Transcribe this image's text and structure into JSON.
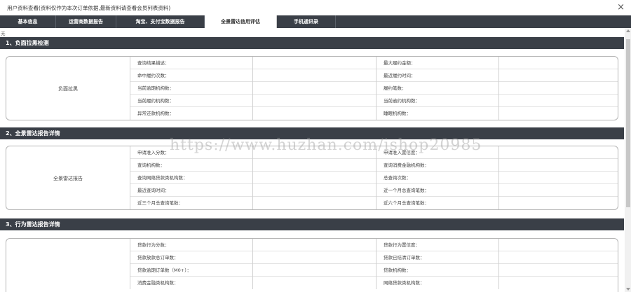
{
  "window": {
    "title": "用户资料查看(资料仅作为本次订单依据,最新资料请查看会员列表资料)",
    "close_glyph": "×"
  },
  "tabs": [
    {
      "label": "基本信息",
      "active": false
    },
    {
      "label": "运营商数据报告",
      "active": false
    },
    {
      "label": "淘宝、支付宝数据报告",
      "active": false
    },
    {
      "label": "全景雷达信用评估",
      "active": true
    },
    {
      "label": "手机通讯录",
      "active": false
    }
  ],
  "nodata_text": "无",
  "sections": [
    {
      "header": "1、负面拉黑检测",
      "group_label": "负面拉黑",
      "rows": [
        [
          "查询结果描述：",
          "最大履约金额："
        ],
        [
          "命中履约次数：",
          "最近履约时间："
        ],
        [
          "当前逾期机构数：",
          "履约笔数："
        ],
        [
          "当前履约机构数：",
          "当前逾约机构数："
        ],
        [
          "异常还款机构数：",
          "睡眠机构数："
        ]
      ]
    },
    {
      "header": "2、全景雷达报告详情",
      "group_label": "全景雷达报告",
      "rows": [
        [
          "申请准入分数：",
          "申请准入置信度："
        ],
        [
          "查询机构数：",
          "查询消费金融机构数："
        ],
        [
          "查询网络贷款类机构数：",
          "总查询次数："
        ],
        [
          "最近查询时间：",
          "近一个月总查询笔数："
        ],
        [
          "近三个月总查询笔数：",
          "近六个月总查询笔数："
        ]
      ]
    },
    {
      "header": "3、行为雷达报告详情",
      "group_label": "",
      "rows": [
        [
          "贷款行为分数：",
          "贷款行为置信度："
        ],
        [
          "贷款放款总订单数：",
          "贷款已结清订单数："
        ],
        [
          "贷款逾期订单数（M0+）：",
          "贷款机构数："
        ],
        [
          "消费金融类机构数：",
          "网络贷款类机构数："
        ]
      ]
    }
  ],
  "watermark": "https://www.huzhan.com/ishop20985"
}
